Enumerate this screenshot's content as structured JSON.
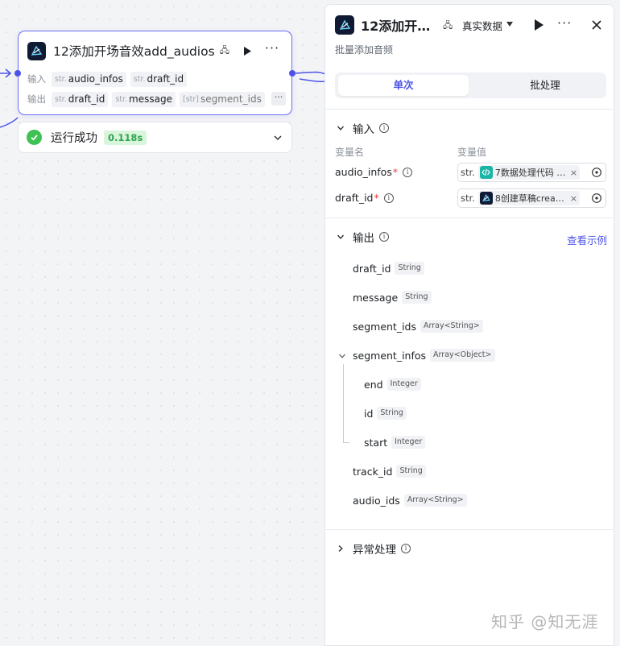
{
  "node": {
    "title": "12添加开场音效add_audios",
    "input_label": "输入",
    "output_label": "输出",
    "type_str": "str.",
    "inputs": [
      "audio_infos",
      "draft_id"
    ],
    "outputs": [
      "draft_id",
      "message",
      "segment_ids"
    ],
    "array_type": "[str]",
    "more": "···"
  },
  "status": {
    "text": "运行成功",
    "time": "0.118s"
  },
  "panel": {
    "title": "12添加开…",
    "mode": "真实数据",
    "more": "···",
    "description": "批量添加音频",
    "tabs": [
      "单次",
      "批处理"
    ],
    "input_section": {
      "title": "输入",
      "col_name": "变量名",
      "col_value": "变量值",
      "vars": [
        {
          "name": "audio_infos",
          "type": "str.",
          "ref": "7数据处理代码 · k…",
          "icon": "code-icon",
          "icon_color": "#1ab5a5"
        },
        {
          "name": "draft_id",
          "type": "str.",
          "ref": "8创建草稿crea… · …",
          "icon": "plugin-logo-icon",
          "icon_color": "#101a33"
        }
      ]
    },
    "output_section": {
      "title": "输出",
      "example_link": "查看示例",
      "fields": [
        {
          "name": "draft_id",
          "type": "String"
        },
        {
          "name": "message",
          "type": "String"
        },
        {
          "name": "segment_ids",
          "type": "Array<String>"
        },
        {
          "name": "segment_infos",
          "type": "Array<Object>"
        },
        {
          "name": "end",
          "type": "Integer"
        },
        {
          "name": "id",
          "type": "String"
        },
        {
          "name": "start",
          "type": "Integer"
        },
        {
          "name": "track_id",
          "type": "String"
        },
        {
          "name": "audio_ids",
          "type": "Array<String>"
        }
      ]
    },
    "error_section": {
      "title": "异常处理"
    }
  },
  "watermark": "知乎 @知无涯",
  "colors": {
    "accent": "#4d53e8",
    "node_border": "#6b6ef7",
    "success": "#3ec254",
    "required": "#e43d3d"
  }
}
